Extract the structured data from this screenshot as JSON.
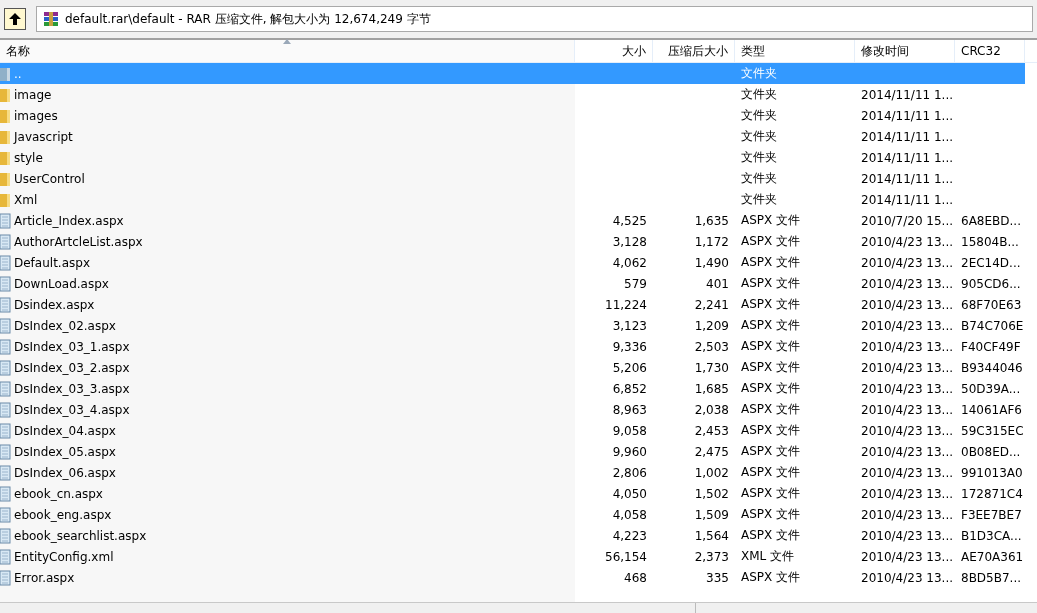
{
  "toolbar": {
    "address": "default.rar\\default - RAR 压缩文件, 解包大小为 12,674,249 字节"
  },
  "table": {
    "columns": [
      {
        "label": "名称",
        "sorted": true
      },
      {
        "label": "大小",
        "sorted": false
      },
      {
        "label": "压缩后大小",
        "sorted": false
      },
      {
        "label": "类型",
        "sorted": false
      },
      {
        "label": "修改时间",
        "sorted": false
      },
      {
        "label": "CRC32",
        "sorted": false
      }
    ],
    "rows": [
      {
        "kind": "up",
        "name": "..",
        "size": "",
        "packed": "",
        "type": "文件夹",
        "modified": "",
        "crc": "",
        "selected": true
      },
      {
        "kind": "folder",
        "name": "image",
        "size": "",
        "packed": "",
        "type": "文件夹",
        "modified": "2014/11/11 1...",
        "crc": "",
        "selected": false
      },
      {
        "kind": "folder",
        "name": "images",
        "size": "",
        "packed": "",
        "type": "文件夹",
        "modified": "2014/11/11 1...",
        "crc": "",
        "selected": false
      },
      {
        "kind": "folder",
        "name": "Javascript",
        "size": "",
        "packed": "",
        "type": "文件夹",
        "modified": "2014/11/11 1...",
        "crc": "",
        "selected": false
      },
      {
        "kind": "folder",
        "name": "style",
        "size": "",
        "packed": "",
        "type": "文件夹",
        "modified": "2014/11/11 1...",
        "crc": "",
        "selected": false
      },
      {
        "kind": "folder",
        "name": "UserControl",
        "size": "",
        "packed": "",
        "type": "文件夹",
        "modified": "2014/11/11 1...",
        "crc": "",
        "selected": false
      },
      {
        "kind": "folder",
        "name": "Xml",
        "size": "",
        "packed": "",
        "type": "文件夹",
        "modified": "2014/11/11 1...",
        "crc": "",
        "selected": false
      },
      {
        "kind": "file",
        "name": "Article_Index.aspx",
        "size": "4,525",
        "packed": "1,635",
        "type": "ASPX 文件",
        "modified": "2010/7/20 15...",
        "crc": "6A8EBD...",
        "selected": false
      },
      {
        "kind": "file",
        "name": "AuthorArtcleList.aspx",
        "size": "3,128",
        "packed": "1,172",
        "type": "ASPX 文件",
        "modified": "2010/4/23 13...",
        "crc": "15804B...",
        "selected": false
      },
      {
        "kind": "file",
        "name": "Default.aspx",
        "size": "4,062",
        "packed": "1,490",
        "type": "ASPX 文件",
        "modified": "2010/4/23 13...",
        "crc": "2EC14D...",
        "selected": false
      },
      {
        "kind": "file",
        "name": "DownLoad.aspx",
        "size": "579",
        "packed": "401",
        "type": "ASPX 文件",
        "modified": "2010/4/23 13...",
        "crc": "905CD6...",
        "selected": false
      },
      {
        "kind": "file",
        "name": "Dsindex.aspx",
        "size": "11,224",
        "packed": "2,241",
        "type": "ASPX 文件",
        "modified": "2010/4/23 13...",
        "crc": "68F70E63",
        "selected": false
      },
      {
        "kind": "file",
        "name": "DsIndex_02.aspx",
        "size": "3,123",
        "packed": "1,209",
        "type": "ASPX 文件",
        "modified": "2010/4/23 13...",
        "crc": "B74C706E",
        "selected": false
      },
      {
        "kind": "file",
        "name": "DsIndex_03_1.aspx",
        "size": "9,336",
        "packed": "2,503",
        "type": "ASPX 文件",
        "modified": "2010/4/23 13...",
        "crc": "F40CF49F",
        "selected": false
      },
      {
        "kind": "file",
        "name": "DsIndex_03_2.aspx",
        "size": "5,206",
        "packed": "1,730",
        "type": "ASPX 文件",
        "modified": "2010/4/23 13...",
        "crc": "B9344046",
        "selected": false
      },
      {
        "kind": "file",
        "name": "DsIndex_03_3.aspx",
        "size": "6,852",
        "packed": "1,685",
        "type": "ASPX 文件",
        "modified": "2010/4/23 13...",
        "crc": "50D39A...",
        "selected": false
      },
      {
        "kind": "file",
        "name": "DsIndex_03_4.aspx",
        "size": "8,963",
        "packed": "2,038",
        "type": "ASPX 文件",
        "modified": "2010/4/23 13...",
        "crc": "14061AF6",
        "selected": false
      },
      {
        "kind": "file",
        "name": "DsIndex_04.aspx",
        "size": "9,058",
        "packed": "2,453",
        "type": "ASPX 文件",
        "modified": "2010/4/23 13...",
        "crc": "59C315EC",
        "selected": false
      },
      {
        "kind": "file",
        "name": "DsIndex_05.aspx",
        "size": "9,960",
        "packed": "2,475",
        "type": "ASPX 文件",
        "modified": "2010/4/23 13...",
        "crc": "0B08ED...",
        "selected": false
      },
      {
        "kind": "file",
        "name": "DsIndex_06.aspx",
        "size": "2,806",
        "packed": "1,002",
        "type": "ASPX 文件",
        "modified": "2010/4/23 13...",
        "crc": "991013A0",
        "selected": false
      },
      {
        "kind": "file",
        "name": "ebook_cn.aspx",
        "size": "4,050",
        "packed": "1,502",
        "type": "ASPX 文件",
        "modified": "2010/4/23 13...",
        "crc": "172871C4",
        "selected": false
      },
      {
        "kind": "file",
        "name": "ebook_eng.aspx",
        "size": "4,058",
        "packed": "1,509",
        "type": "ASPX 文件",
        "modified": "2010/4/23 13...",
        "crc": "F3EE7BE7",
        "selected": false
      },
      {
        "kind": "file",
        "name": "ebook_searchlist.aspx",
        "size": "4,223",
        "packed": "1,564",
        "type": "ASPX 文件",
        "modified": "2010/4/23 13...",
        "crc": "B1D3CA...",
        "selected": false
      },
      {
        "kind": "file",
        "name": "EntityConfig.xml",
        "size": "56,154",
        "packed": "2,373",
        "type": "XML 文件",
        "modified": "2010/4/23 13...",
        "crc": "AE70A361",
        "selected": false
      },
      {
        "kind": "file",
        "name": "Error.aspx",
        "size": "468",
        "packed": "335",
        "type": "ASPX 文件",
        "modified": "2010/4/23 13...",
        "crc": "8BD5B7...",
        "selected": false
      }
    ]
  }
}
